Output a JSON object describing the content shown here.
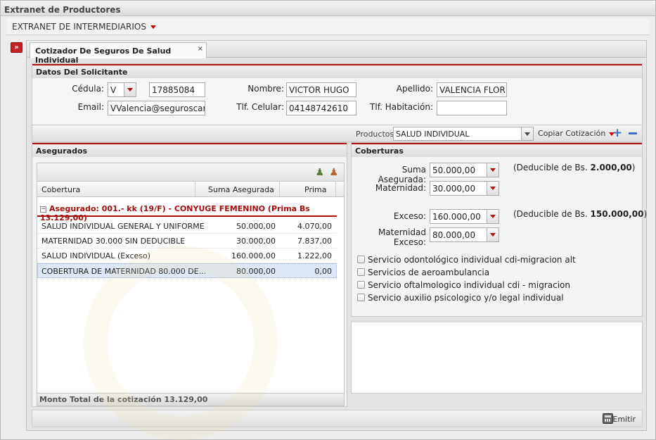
{
  "window": {
    "title": "Extranet de Productores"
  },
  "menu": {
    "label": "EXTRANET DE INTERMEDIARIOS"
  },
  "tab": {
    "label": "Cotizador De Seguros De Salud Individual",
    "close": "×"
  },
  "solicitante": {
    "header": "Datos Del Solicitante",
    "cedula_label": "Cédula:",
    "cedula_type": "V",
    "cedula_number": "17885084",
    "nombre_label": "Nombre:",
    "nombre_value": "VICTOR HUGO",
    "apellido_label": "Apellido:",
    "apellido_value": "VALENCIA FLOR",
    "email_label": "Email:",
    "email_value": "VValencia@seguroscaracas",
    "celular_label": "Tlf. Celular:",
    "celular_value": "04148742610",
    "habitacion_label": "Tlf. Habitación:",
    "habitacion_value": ""
  },
  "productos": {
    "label": "Productos",
    "value": "SALUD INDIVIDUAL",
    "copiar": "Copiar Cotización"
  },
  "asegurados": {
    "header": "Asegurados",
    "columns": [
      "Cobertura",
      "Suma Asegurada",
      "Prima"
    ],
    "group_label": "Asegurado: 001.- kk (19/F) - CONYUGE FEMENINO (Prima Bs 13.129,00)",
    "rows": [
      {
        "cobertura": "SALUD INDIVIDUAL GENERAL Y UNIFORME",
        "suma": "50.000,00",
        "prima": "4.070,00"
      },
      {
        "cobertura": "MATERNIDAD 30.000 SIN DEDUCIBLE",
        "suma": "30.000,00",
        "prima": "7.837,00"
      },
      {
        "cobertura": "SALUD INDIVIDUAL (Exceso)",
        "suma": "160.000,00",
        "prima": "1.222,00"
      },
      {
        "cobertura": "COBERTURA DE MATERNIDAD 80.000 DE...",
        "suma": "80.000,00",
        "prima": "0,00"
      }
    ],
    "footer": "Monto Total de la cotización 13.129,00"
  },
  "coberturas": {
    "header": "Coberturas",
    "suma_label": "Suma Asegurada:",
    "suma_value": "50.000,00",
    "deducible1_prefix": "(Deducible de Bs. ",
    "deducible1_amount": "2.000,00",
    "deducible1_suffix": ")",
    "maternidad_label": "Maternidad:",
    "maternidad_value": "30.000,00",
    "exceso_label": "Exceso:",
    "exceso_value": "160.000,00",
    "deducible2_prefix": "(Deducible de Bs. ",
    "deducible2_amount": "150.000,00",
    "deducible2_suffix": ")",
    "mat_exceso_label_1": "Maternidad",
    "mat_exceso_label_2": "Exceso:",
    "mat_exceso_value": "80.000,00",
    "services": [
      "Servicio odontológico individual cdi-migracion alt",
      "Servicios de aeroambulancia",
      "Servicio oftalmologico individual cdi - migracion",
      "Servicio auxilio psicologico y/o legal individual"
    ]
  },
  "footer": {
    "emitir": "Emitir"
  },
  "icons": {
    "side_toggle": "double-chevron-right-icon",
    "add_user": "add-user-icon",
    "remove_user": "remove-user-icon",
    "add": "plus-icon",
    "remove": "minus-icon",
    "calculator": "calculator-icon"
  },
  "colors": {
    "accent": "#b01010",
    "selection": "#dde7f5"
  }
}
